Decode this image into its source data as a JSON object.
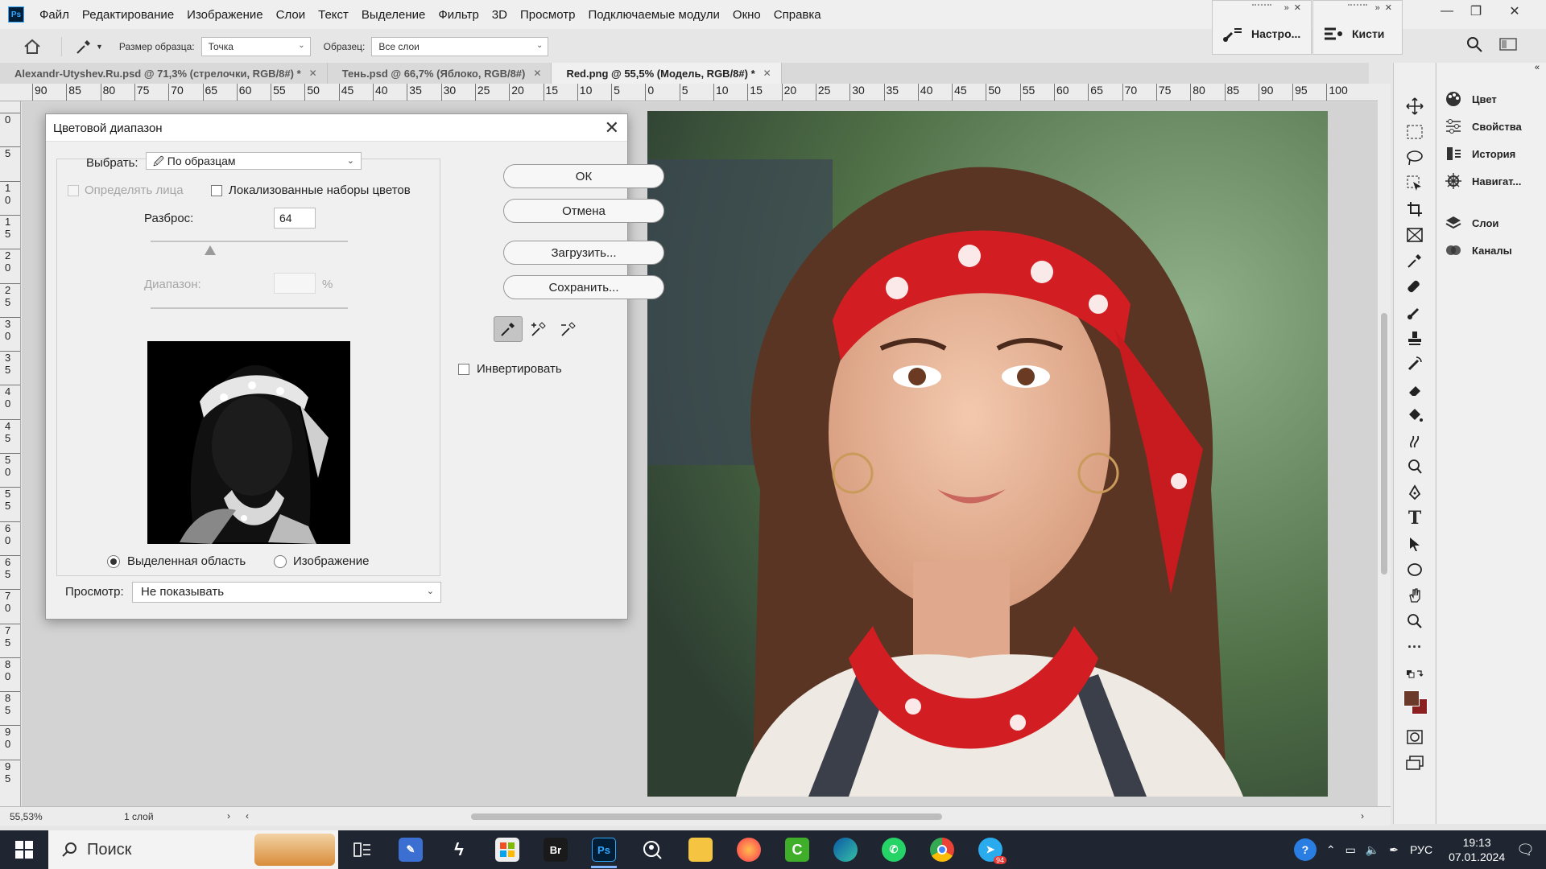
{
  "app": {
    "logo": "Ps"
  },
  "menu": [
    "Файл",
    "Редактирование",
    "Изображение",
    "Слои",
    "Текст",
    "Выделение",
    "Фильтр",
    "3D",
    "Просмотр",
    "Подключаемые модули",
    "Окно",
    "Справка"
  ],
  "mini_panels": [
    {
      "label": "Настро...",
      "icon": "brush-settings-icon"
    },
    {
      "label": "Кисти",
      "icon": "brushes-icon"
    }
  ],
  "options_bar": {
    "sample_size_label": "Размер образца:",
    "sample_size_value": "Точка",
    "sample_label": "Образец:",
    "sample_value": "Все слои"
  },
  "tabs": [
    {
      "label": "Alexandr-Utyshev.Ru.psd @ 71,3% (стрелочки, RGB/8#) *",
      "active": false
    },
    {
      "label": "Тень.psd @ 66,7% (Яблоко, RGB/8#)",
      "active": false
    },
    {
      "label": "Red.png @ 55,5% (Модель, RGB/8#) *",
      "active": true
    }
  ],
  "ruler_h": [
    "90",
    "85",
    "80",
    "75",
    "70",
    "65",
    "60",
    "55",
    "50",
    "45",
    "40",
    "35",
    "30",
    "25",
    "20",
    "15",
    "10",
    "5",
    "0",
    "5",
    "10",
    "15",
    "20",
    "25",
    "30",
    "35",
    "40",
    "45",
    "50",
    "55",
    "60",
    "65",
    "70",
    "75",
    "80",
    "85",
    "90",
    "95",
    "100"
  ],
  "ruler_v": [
    "0",
    "5",
    "1 0",
    "1 5",
    "2 0",
    "2 5",
    "3 0",
    "3 5",
    "4 0",
    "4 5",
    "5 0",
    "5 5",
    "6 0",
    "6 5",
    "7 0",
    "7 5",
    "8 0",
    "8 5",
    "9 0",
    "9 5"
  ],
  "status": {
    "zoom": "55,53%",
    "layers": "1 слой"
  },
  "dialog": {
    "title": "Цветовой диапазон",
    "select_label": "Выбрать:",
    "select_value": "По образцам",
    "detect_faces_label": "Определять лица",
    "localized_label": "Локализованные наборы цветов",
    "fuzziness_label": "Разброс:",
    "fuzziness_value": "64",
    "fuzziness_slider": 0.3,
    "range_label": "Диапазон:",
    "range_value": "",
    "range_unit": "%",
    "radio_selection": "Выделенная область",
    "radio_image": "Изображение",
    "preview_label": "Просмотр:",
    "preview_value": "Не показывать",
    "btn_ok": "ОК",
    "btn_cancel": "Отмена",
    "btn_load": "Загрузить...",
    "btn_save": "Сохранить...",
    "invert_label": "Инвертировать"
  },
  "panels": [
    {
      "label": "Цвет",
      "icon": "palette-icon"
    },
    {
      "label": "Свойства",
      "icon": "properties-icon"
    },
    {
      "label": "История",
      "icon": "history-icon"
    },
    {
      "label": "Навигат...",
      "icon": "navigator-icon"
    },
    {
      "label": "Слои",
      "icon": "layers-icon"
    },
    {
      "label": "Каналы",
      "icon": "channels-icon"
    }
  ],
  "colors": {
    "foreground": "#6b3a2a",
    "background": "#8a2020",
    "accent": "#31a8ff"
  },
  "taskbar": {
    "search_placeholder": "Поиск",
    "apps": [
      "Bridge",
      "Photoshop",
      "Firefox",
      "Camtasia",
      "Edge",
      "WhatsApp",
      "Chrome",
      "Telegram"
    ],
    "telegram_badge": "94",
    "lang": "РУС",
    "time": "19:13",
    "date": "07.01.2024"
  }
}
